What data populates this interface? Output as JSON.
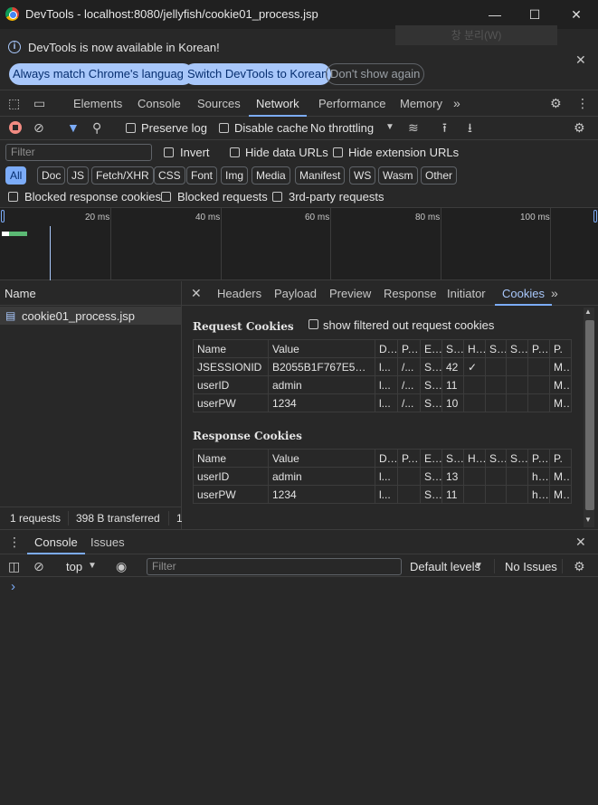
{
  "window": {
    "title": "DevTools - localhost:8080/jellyfish/cookie01_process.jsp"
  },
  "infobar": {
    "message": "DevTools is now available in Korean!",
    "btn_match": "Always match Chrome's language",
    "btn_switch": "Switch DevTools to Korean",
    "btn_dont_show": "Don't show again",
    "ghost_text": "창 분리(W)"
  },
  "tabs": [
    "Elements",
    "Console",
    "Sources",
    "Network",
    "Performance",
    "Memory"
  ],
  "active_tab": "Network",
  "toolbar": {
    "preserve_log": "Preserve log",
    "disable_cache": "Disable cache",
    "throttling": "No throttling"
  },
  "filter": {
    "placeholder": "Filter",
    "invert": "Invert",
    "hide_data_urls": "Hide data URLs",
    "hide_extension_urls": "Hide extension URLs"
  },
  "types": [
    "All",
    "Doc",
    "JS",
    "Fetch/XHR",
    "CSS",
    "Font",
    "Img",
    "Media",
    "Manifest",
    "WS",
    "Wasm",
    "Other"
  ],
  "blocks": {
    "blocked_cookies": "Blocked response cookies",
    "blocked_requests": "Blocked requests",
    "third_party": "3rd-party requests"
  },
  "timeline": {
    "ticks": [
      "20 ms",
      "40 ms",
      "60 ms",
      "80 ms",
      "100 ms"
    ]
  },
  "requests": {
    "header": "Name",
    "items": [
      "cookie01_process.jsp"
    ],
    "status_requests": "1 requests",
    "status_transferred": "398 B transferred",
    "status_more": "1"
  },
  "detail_tabs": [
    "Headers",
    "Payload",
    "Preview",
    "Response",
    "Initiator",
    "Cookies"
  ],
  "active_detail_tab": "Cookies",
  "cookies": {
    "request_title": "Request Cookies",
    "show_filtered": "show filtered out request cookies",
    "response_title": "Response Cookies",
    "columns": [
      "Name",
      "Value",
      "D...",
      "P...",
      "E...",
      "S...",
      "H...",
      "S...",
      "S...",
      "P...",
      "P."
    ],
    "request_rows": [
      [
        "JSESSIONID",
        "B2055B1F767E565...",
        "l...",
        "/...",
        "S...",
        "42",
        "✓",
        "",
        "",
        "",
        "M..."
      ],
      [
        "userID",
        "admin",
        "l...",
        "/...",
        "S...",
        "11",
        "",
        "",
        "",
        "",
        "M..."
      ],
      [
        "userPW",
        "1234",
        "l...",
        "/...",
        "S...",
        "10",
        "",
        "",
        "",
        "",
        "M..."
      ]
    ],
    "response_rows": [
      [
        "userID",
        "admin",
        "l...",
        "",
        "S...",
        "13",
        "",
        "",
        "",
        "h...",
        "M..."
      ],
      [
        "userPW",
        "1234",
        "l...",
        "",
        "S...",
        "11",
        "",
        "",
        "",
        "h...",
        "M..."
      ]
    ]
  },
  "drawer": {
    "tab_console": "Console",
    "tab_issues": "Issues",
    "context": "top",
    "filter_placeholder": "Filter",
    "levels": "Default levels",
    "issues": "No Issues",
    "prompt": "›"
  }
}
